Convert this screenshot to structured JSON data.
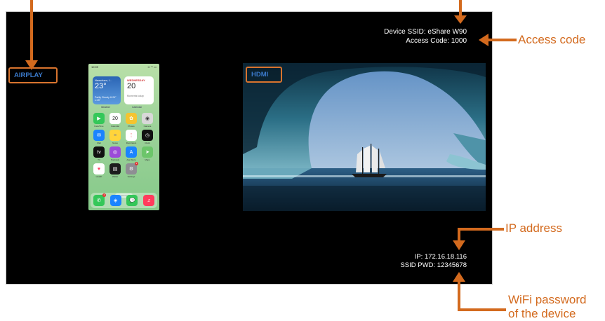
{
  "screen": {
    "device_ssid_text": "Device SSID: eShare W90",
    "access_code_text": "Access Code: 1000",
    "ip_text": "IP: 172.16.18.116",
    "ssid_pwd_text": "SSID PWD: 12345678",
    "airplay_label": "AIRPLAY",
    "hdmi_label": "HDMI"
  },
  "phone": {
    "status_time": "10:09",
    "weather": {
      "city": "Newcham, I...",
      "temp": "23°",
      "condition": "Partly Cloudy H:24° L:15°"
    },
    "calendar": {
      "day": "WEDNESDAY",
      "date": "20",
      "event": "Moments today"
    },
    "widget_labels": [
      "Weather",
      "Calendar"
    ],
    "apps": [
      {
        "name": "FaceTime",
        "icon": "video-icon",
        "color": "#34c759",
        "glyph": "▶"
      },
      {
        "name": "Calendar",
        "icon": "calendar-icon",
        "color": "#ffffff",
        "glyph": "20",
        "glyph_color": "#222"
      },
      {
        "name": "Photos",
        "icon": "photos-icon",
        "color": "#f4c430",
        "glyph": "✿"
      },
      {
        "name": "Camera",
        "icon": "camera-icon",
        "color": "#d8d8d8",
        "glyph": "◉",
        "glyph_color": "#333"
      },
      {
        "name": "Mail",
        "icon": "mail-icon",
        "color": "#1a84ff",
        "glyph": "✉"
      },
      {
        "name": "Notes",
        "icon": "notes-icon",
        "color": "#ffd43b",
        "glyph": "≡",
        "glyph_color": "#888"
      },
      {
        "name": "Reminders",
        "icon": "reminders-icon",
        "color": "#ffffff",
        "glyph": "⋮",
        "glyph_color": "#e55"
      },
      {
        "name": "Clock",
        "icon": "clock-icon",
        "color": "#111111",
        "glyph": "◷"
      },
      {
        "name": "TV",
        "icon": "tv-icon",
        "color": "#111111",
        "glyph": "tv"
      },
      {
        "name": "Podcasts",
        "icon": "podcasts-icon",
        "color": "#9b4ad8",
        "glyph": "◎"
      },
      {
        "name": "App Store",
        "icon": "app-store-icon",
        "color": "#1a84ff",
        "glyph": "A"
      },
      {
        "name": "Maps",
        "icon": "maps-icon",
        "color": "#6cc56a",
        "glyph": "➤"
      },
      {
        "name": "Health",
        "icon": "health-icon",
        "color": "#ffffff",
        "glyph": "♥",
        "glyph_color": "#ff3b5c"
      },
      {
        "name": "Wallet",
        "icon": "wallet-icon",
        "color": "#1c1c1c",
        "glyph": "▤"
      },
      {
        "name": "Settings",
        "icon": "settings-icon",
        "color": "#8e8e93",
        "glyph": "⚙",
        "badge": "2"
      }
    ],
    "search_label": "Search",
    "dock": [
      {
        "icon": "phone-icon",
        "color": "#34c759",
        "glyph": "✆",
        "badge": "4"
      },
      {
        "icon": "safari-icon",
        "color": "#1a84ff",
        "glyph": "◈"
      },
      {
        "icon": "messages-icon",
        "color": "#34c759",
        "glyph": "💬"
      },
      {
        "icon": "music-icon",
        "color": "#ff3b5c",
        "glyph": "♫"
      }
    ]
  },
  "annotations": {
    "access_code": "Access code",
    "ip_address": "IP address",
    "wifi_password_line1": "WiFi password",
    "wifi_password_line2": "of the device"
  },
  "colors": {
    "annotation": "#d36a1e",
    "tag_text": "#3a78c8",
    "screen_bg": "#000000"
  }
}
